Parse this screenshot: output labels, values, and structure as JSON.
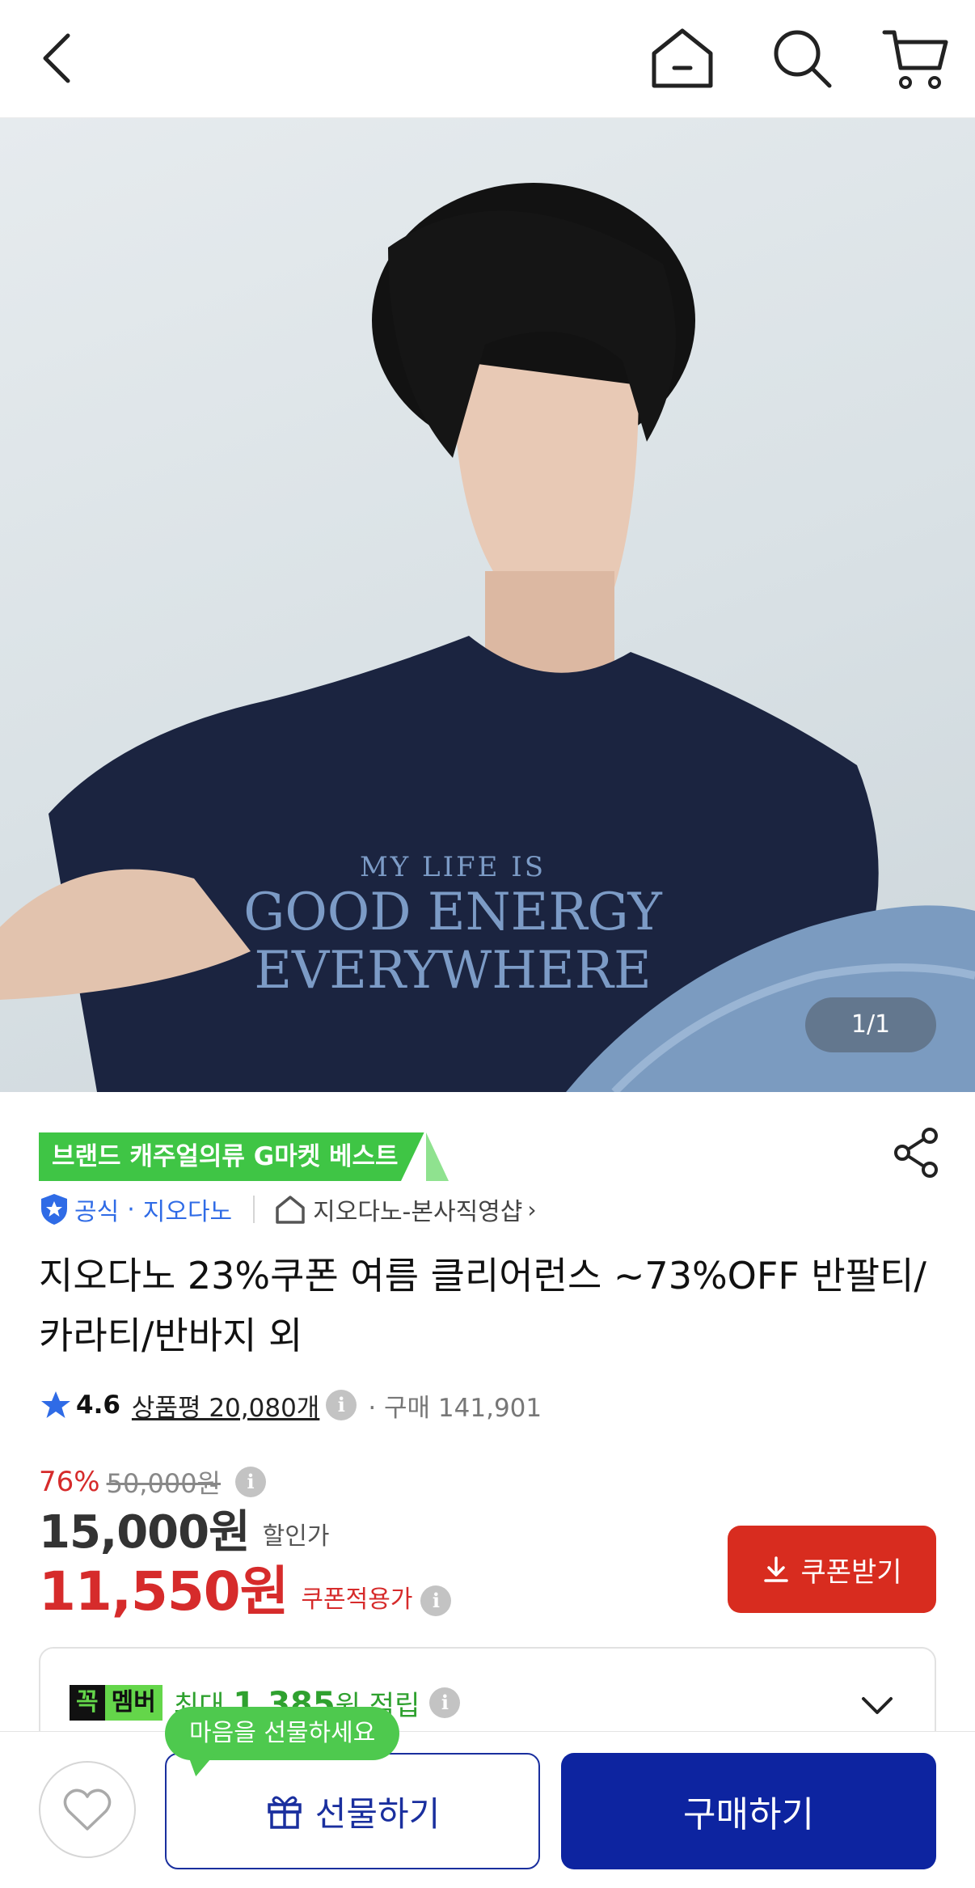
{
  "header": {
    "icons": [
      "chevron-left-icon",
      "home-icon",
      "search-icon",
      "cart-icon"
    ]
  },
  "hero": {
    "image_text": [
      "MY LIFE IS",
      "GOOD ENERGY",
      "EVERYWHERE"
    ],
    "counter": "1/1"
  },
  "product": {
    "badge": "브랜드 캐주얼의류 G마켓 베스트",
    "official": "공식",
    "separator": "·",
    "brand": "지오다노",
    "shop": "지오다노-본사직영샵",
    "title": "지오다노 23%쿠폰 여름 클리어런스 ~73%OFF  반팔티/카라티/반바지 외",
    "rating": "4.6",
    "reviews": "상품평 20,080개",
    "purchase_count": "· 구매 141,901"
  },
  "price": {
    "discount_rate": "76%",
    "original": "50,000원",
    "sale": "15,000원",
    "sale_label": "할인가",
    "coupon_price": "11,550원",
    "coupon_label": "쿠폰적용가",
    "coupon_button": "쿠폰받기"
  },
  "member": {
    "tag_a": "꼭",
    "tag_b": "멤버",
    "text_prefix": "최대 ",
    "amount": "1,385",
    "text_suffix": "원 적립"
  },
  "bottom": {
    "tooltip": "마음을 선물하세요",
    "gift_button": "선물하기",
    "buy_button": "구매하기"
  },
  "colors": {
    "accent_red": "#d62b2b",
    "brand_blue": "#0d24a0",
    "badge_green": "#3fc545",
    "link_blue": "#2f6be6"
  }
}
